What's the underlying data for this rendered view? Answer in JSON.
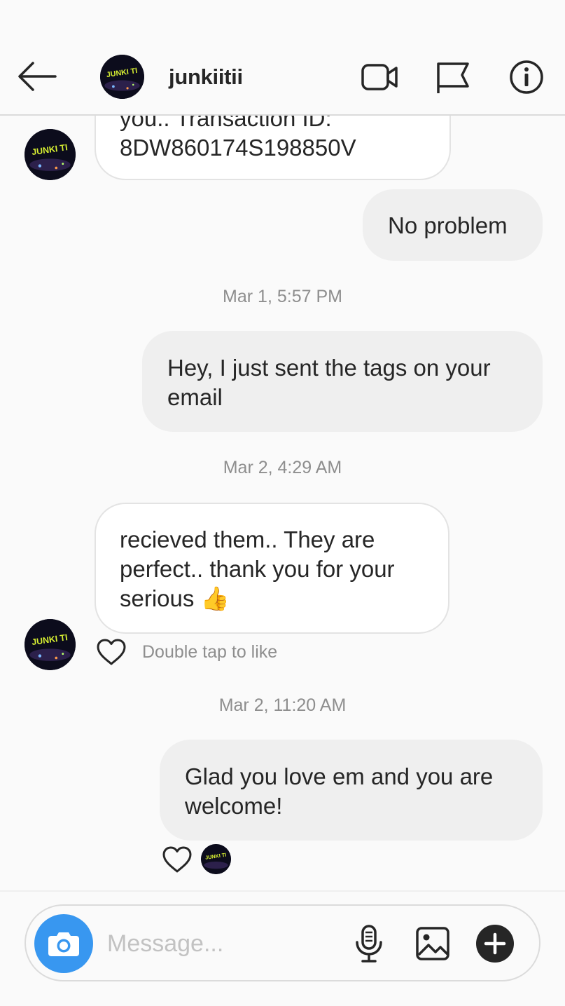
{
  "header": {
    "username": "junkiitii",
    "avatar_text": "JUNKI TI"
  },
  "messages": [
    {
      "direction": "received",
      "lines": [
        "you.. Transaction ID:",
        "8DW860174S198850V"
      ]
    },
    {
      "direction": "sent",
      "lines": [
        "No problem"
      ]
    },
    {
      "timestamp": "Mar 1, 5:57 PM"
    },
    {
      "direction": "sent",
      "lines": [
        "Hey, I just sent the tags on your",
        "email"
      ]
    },
    {
      "timestamp": "Mar 2, 4:29 AM"
    },
    {
      "direction": "received",
      "lines": [
        "recieved them.. They are",
        "perfect.. thank you for your",
        "serious"
      ],
      "emoji": "👍"
    },
    {
      "hint": "Double tap to like"
    },
    {
      "timestamp": "Mar 2, 11:20 AM"
    },
    {
      "direction": "sent",
      "lines": [
        "Glad you love em and you are",
        "welcome!"
      ]
    }
  ],
  "composer": {
    "placeholder": "Message..."
  },
  "colors": {
    "accent": "#3897f0",
    "received_bubble_bg": "#ffffff",
    "sent_bubble_bg": "#efefef",
    "muted_text": "#8e8e8e"
  },
  "icons": [
    "back-arrow-icon",
    "video-call-icon",
    "flag-icon",
    "info-icon",
    "heart-icon",
    "camera-icon",
    "microphone-icon",
    "gallery-icon",
    "plus-icon"
  ]
}
